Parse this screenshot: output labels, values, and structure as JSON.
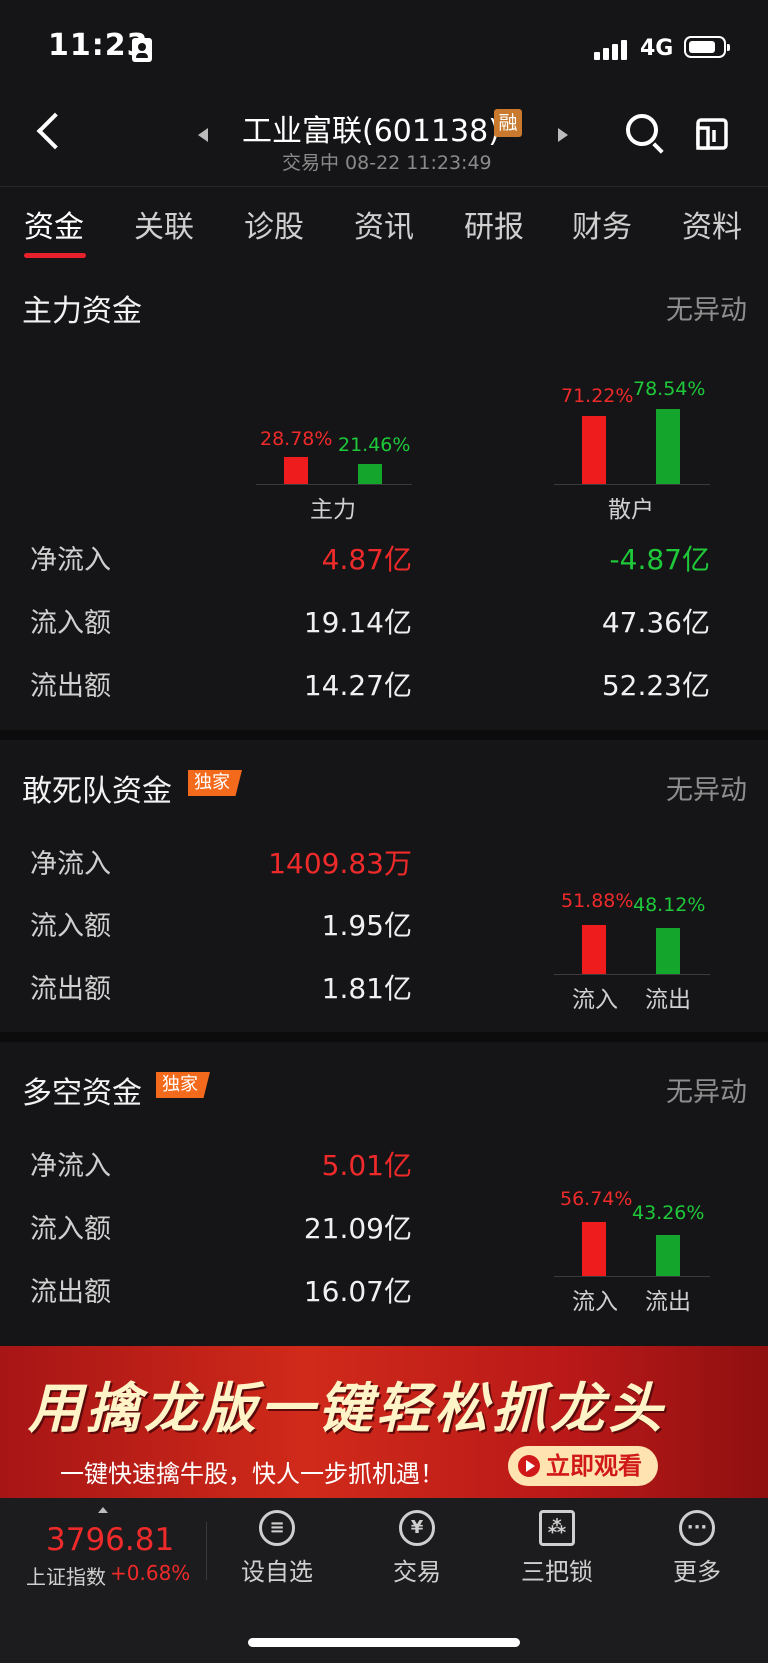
{
  "status_bar": {
    "time": "11:23",
    "network": "4G"
  },
  "header": {
    "title": "工业富联(601138)",
    "badge": "融",
    "subtitle": "交易中 08-22 11:23:49"
  },
  "tabs": [
    "资金",
    "关联",
    "诊股",
    "资讯",
    "研报",
    "财务",
    "资料"
  ],
  "main_funds": {
    "title": "主力资金",
    "note": "无异动",
    "chart": {
      "groups": [
        {
          "label": "主力",
          "in_pct": "28.78%",
          "out_pct": "21.46%",
          "in_value": 28.78,
          "out_value": 21.46
        },
        {
          "label": "散户",
          "in_pct": "71.22%",
          "out_pct": "78.54%",
          "in_value": 71.22,
          "out_value": 78.54
        }
      ]
    },
    "rows": [
      {
        "label": "净流入",
        "main": "4.87亿",
        "retail": "-4.87亿"
      },
      {
        "label": "流入额",
        "main": "19.14亿",
        "retail": "47.36亿"
      },
      {
        "label": "流出额",
        "main": "14.27亿",
        "retail": "52.23亿"
      }
    ]
  },
  "dare_funds": {
    "title": "敢死队资金",
    "tag": "独家",
    "note": "无异动",
    "rows": [
      {
        "label": "净流入",
        "value": "1409.83万"
      },
      {
        "label": "流入额",
        "value": "1.95亿"
      },
      {
        "label": "流出额",
        "value": "1.81亿"
      }
    ],
    "chart": {
      "in_pct": "51.88%",
      "out_pct": "48.12%",
      "in_value": 51.88,
      "out_value": 48.12,
      "in_label": "流入",
      "out_label": "流出"
    }
  },
  "longshort_funds": {
    "title": "多空资金",
    "tag": "独家",
    "note": "无异动",
    "rows": [
      {
        "label": "净流入",
        "value": "5.01亿"
      },
      {
        "label": "流入额",
        "value": "21.09亿"
      },
      {
        "label": "流出额",
        "value": "16.07亿"
      }
    ],
    "chart": {
      "in_pct": "56.74%",
      "out_pct": "43.26%",
      "in_value": 56.74,
      "out_value": 43.26,
      "in_label": "流入",
      "out_label": "流出"
    }
  },
  "banner": {
    "headline": "用擒龙版一键轻松抓龙头",
    "sub": "一键快速擒牛股，快人一步抓机遇！",
    "button": "立即观看"
  },
  "bottom_bar": {
    "index_value": "3796.81",
    "index_name": "上证指数",
    "index_change": "+0.68%",
    "items": [
      "设自选",
      "交易",
      "三把锁",
      "更多"
    ]
  },
  "colors": {
    "up": "#ef2a2a",
    "down": "#1ec93a",
    "accent": "#e8202c"
  }
}
